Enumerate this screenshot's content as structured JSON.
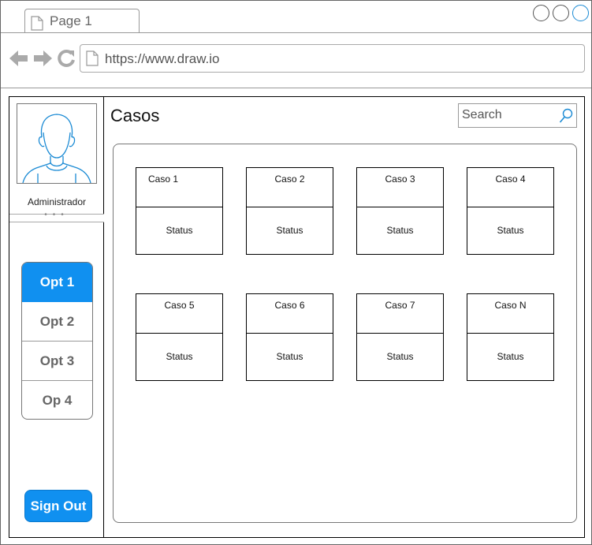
{
  "browser": {
    "tab_label": "Page 1",
    "url": "https://www.draw.io",
    "accent_color": "#1a8ad4"
  },
  "sidebar": {
    "user_name": "Administrador",
    "menu": [
      {
        "label": "Opt 1",
        "active": true
      },
      {
        "label": "Opt 2",
        "active": false
      },
      {
        "label": "Opt 3",
        "active": false
      },
      {
        "label": "Op 4",
        "active": false
      }
    ],
    "sign_out_label": "Sign Out",
    "primary_color": "#1090f0"
  },
  "main": {
    "title": "Casos",
    "search": {
      "placeholder": "Search"
    },
    "cases": [
      {
        "name": "Caso 1",
        "status": "Status"
      },
      {
        "name": "Caso 2",
        "status": "Status"
      },
      {
        "name": "Caso 3",
        "status": "Status"
      },
      {
        "name": "Caso 4",
        "status": "Status"
      },
      {
        "name": "Caso 5",
        "status": "Status"
      },
      {
        "name": "Caso 6",
        "status": "Status"
      },
      {
        "name": "Caso 7",
        "status": "Status"
      },
      {
        "name": "Caso N",
        "status": "Status"
      }
    ]
  },
  "icons": {
    "tab": "page-icon",
    "back": "arrow-left-icon",
    "forward": "arrow-right-icon",
    "reload": "reload-icon",
    "search": "search-icon",
    "avatar": "user-avatar-icon"
  }
}
